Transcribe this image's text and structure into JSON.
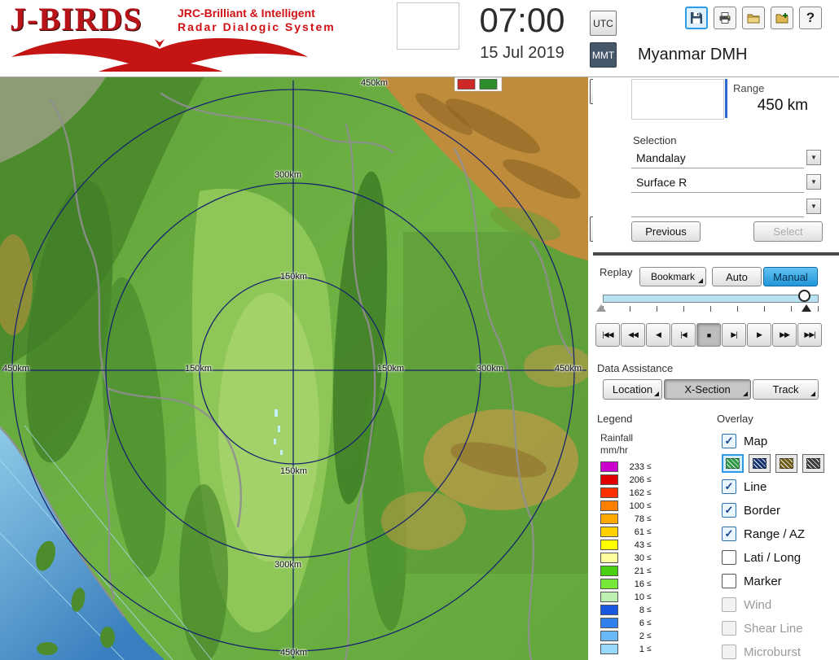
{
  "header": {
    "logo": {
      "title": "J-BIRDS",
      "tagline1": "JRC-Brilliant & Intelligent",
      "tagline2": "Radar Dialogic System"
    },
    "clock": {
      "time": "07:00",
      "date": "15 Jul 2019"
    },
    "timezone": {
      "utc": "UTC",
      "mmt": "MMT",
      "selected": "MMT"
    },
    "toolbar": {
      "help_label": "?",
      "icons": [
        "save",
        "print",
        "open-folder",
        "add-folder",
        "help"
      ]
    },
    "station": "Myanmar DMH"
  },
  "panel": {
    "range": {
      "label": "Range",
      "value": "450 km"
    },
    "selection": {
      "label": "Selection",
      "dropdowns": [
        "Mandalay",
        "Surface R",
        ""
      ],
      "arrow_glyph": "▼"
    },
    "previous_label": "Previous",
    "select_label": "Select",
    "replay": {
      "label": "Replay",
      "bookmark": "Bookmark",
      "auto": "Auto",
      "manual": "Manual",
      "active_mode": "Manual",
      "playback": [
        {
          "name": "skip-to-start",
          "glyph": "|◀◀",
          "pressed": false
        },
        {
          "name": "fast-rewind",
          "glyph": "◀◀",
          "pressed": false
        },
        {
          "name": "play-reverse",
          "glyph": "◀",
          "pressed": false
        },
        {
          "name": "step-back",
          "glyph": "|◀",
          "pressed": false
        },
        {
          "name": "stop",
          "glyph": "■",
          "pressed": true
        },
        {
          "name": "step-forward",
          "glyph": "▶|",
          "pressed": false
        },
        {
          "name": "play",
          "glyph": "▶",
          "pressed": false
        },
        {
          "name": "fast-forward",
          "glyph": "▶▶",
          "pressed": false
        },
        {
          "name": "skip-to-end",
          "glyph": "▶▶|",
          "pressed": false
        }
      ]
    },
    "data_assistance": {
      "label": "Data Assistance",
      "buttons": [
        {
          "label": "Location",
          "pressed": false
        },
        {
          "label": "X-Section",
          "pressed": true
        },
        {
          "label": "Track",
          "pressed": false
        }
      ]
    },
    "legend": {
      "label": "Legend",
      "rainfall": "Rainfall",
      "unit": "mm/hr",
      "suffix": "≤",
      "entries": [
        {
          "value": "233",
          "color": "#cc00cc"
        },
        {
          "value": "206",
          "color": "#e00000"
        },
        {
          "value": "162",
          "color": "#ff3000"
        },
        {
          "value": "100",
          "color": "#ff8000"
        },
        {
          "value": "78",
          "color": "#ffa800"
        },
        {
          "value": "61",
          "color": "#ffd000"
        },
        {
          "value": "43",
          "color": "#ffff00"
        },
        {
          "value": "30",
          "color": "#ffffa0"
        },
        {
          "value": "21",
          "color": "#48d010"
        },
        {
          "value": "16",
          "color": "#78e838"
        },
        {
          "value": "10",
          "color": "#c0f0b0"
        },
        {
          "value": "8",
          "color": "#1858e0"
        },
        {
          "value": "6",
          "color": "#3080f0"
        },
        {
          "value": "2",
          "color": "#68b8f8"
        },
        {
          "value": "1",
          "color": "#98d8f8"
        }
      ]
    },
    "overlay": {
      "label": "Overlay",
      "items": [
        {
          "label": "Map",
          "checked": true,
          "enabled": true
        },
        {
          "label": "Line",
          "checked": true,
          "enabled": true
        },
        {
          "label": "Border",
          "checked": true,
          "enabled": true
        },
        {
          "label": "Range / AZ",
          "checked": true,
          "enabled": true
        },
        {
          "label": "Lati / Long",
          "checked": false,
          "enabled": true
        },
        {
          "label": "Marker",
          "checked": false,
          "enabled": true
        },
        {
          "label": "Wind",
          "checked": false,
          "enabled": false
        },
        {
          "label": "Shear Line",
          "checked": false,
          "enabled": false
        },
        {
          "label": "Microburst",
          "checked": false,
          "enabled": false
        }
      ],
      "map_styles": [
        {
          "name": "green",
          "color": "#2f9a40",
          "selected": true
        },
        {
          "name": "navy",
          "color": "#15336e",
          "selected": false
        },
        {
          "name": "olive",
          "color": "#6e5c14",
          "selected": false
        },
        {
          "name": "dark-gray",
          "color": "#3c3c3c",
          "selected": false
        }
      ]
    }
  },
  "map": {
    "ring_labels": [
      "450km",
      "300km",
      "150km",
      "450km",
      "150km",
      "150km",
      "300km",
      "450km",
      "150km",
      "300km",
      "450km"
    ]
  }
}
